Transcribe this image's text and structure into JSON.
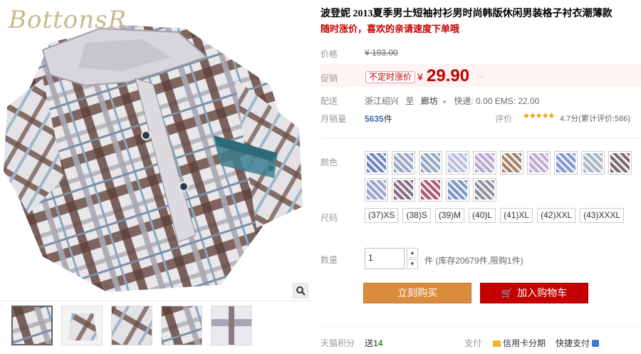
{
  "brand_logo": "BottonsR",
  "product": {
    "title": "波登妮 2013夏季男士短袖衬衫男时尚韩版休闲男装格子衬衣潮薄款",
    "subtitle": "随时涨价，喜欢的亲请速度下单哦"
  },
  "labels": {
    "price": "价格",
    "promo": "促销",
    "shipping": "配送",
    "monthly_sales": "月销量",
    "rating": "评价",
    "color": "颜色",
    "size": "尺码",
    "quantity": "数量",
    "points": "天猫积分",
    "payment": "支付"
  },
  "price": {
    "original": "¥ 193.00",
    "promo_tag": "不定时涨价",
    "currency": "¥",
    "current": "29.90"
  },
  "shipping": {
    "from": "浙江绍兴",
    "to_word": "至",
    "to": "廊坊",
    "fees": "快递: 0.00 EMS: 22.00"
  },
  "sales": {
    "count": "5635",
    "unit": "件"
  },
  "rating": {
    "stars": "★★★★★",
    "text": "4.7分(累计评价:586)"
  },
  "colors": [
    {
      "name": "color-1",
      "hex": "#6b86c4"
    },
    {
      "name": "color-2",
      "hex": "#9aa6c6"
    },
    {
      "name": "color-3",
      "hex": "#8fa9c0"
    },
    {
      "name": "color-4",
      "hex": "#b8bfe0"
    },
    {
      "name": "color-5",
      "hex": "#b6a7d6"
    },
    {
      "name": "color-6",
      "hex": "#a58160"
    },
    {
      "name": "color-7",
      "hex": "#c5a8d6"
    },
    {
      "name": "color-8",
      "hex": "#7f96d1"
    },
    {
      "name": "color-9",
      "hex": "#a9b6c2"
    },
    {
      "name": "color-10",
      "hex": "#7c6a6a"
    },
    {
      "name": "color-11",
      "hex": "#9aa4c8"
    },
    {
      "name": "color-12",
      "hex": "#8a6b84"
    },
    {
      "name": "color-13",
      "hex": "#b1566e"
    },
    {
      "name": "color-14",
      "hex": "#7b93c7"
    },
    {
      "name": "color-15",
      "hex": "#8d8f99"
    }
  ],
  "sizes": [
    "(37)XS",
    "(38)S",
    "(39)M",
    "(40)L",
    "(41)XL",
    "(42)XXL",
    "(43)XXXL"
  ],
  "quantity": {
    "value": "1",
    "stock_text": "件 (库存20679件,限购1件)"
  },
  "buttons": {
    "buy_now": "立刻购买",
    "add_to_cart": "加入购物车"
  },
  "points": {
    "prefix": "送",
    "value": "14"
  },
  "payment": {
    "option1": "信用卡分期",
    "option2": "快捷支付"
  }
}
